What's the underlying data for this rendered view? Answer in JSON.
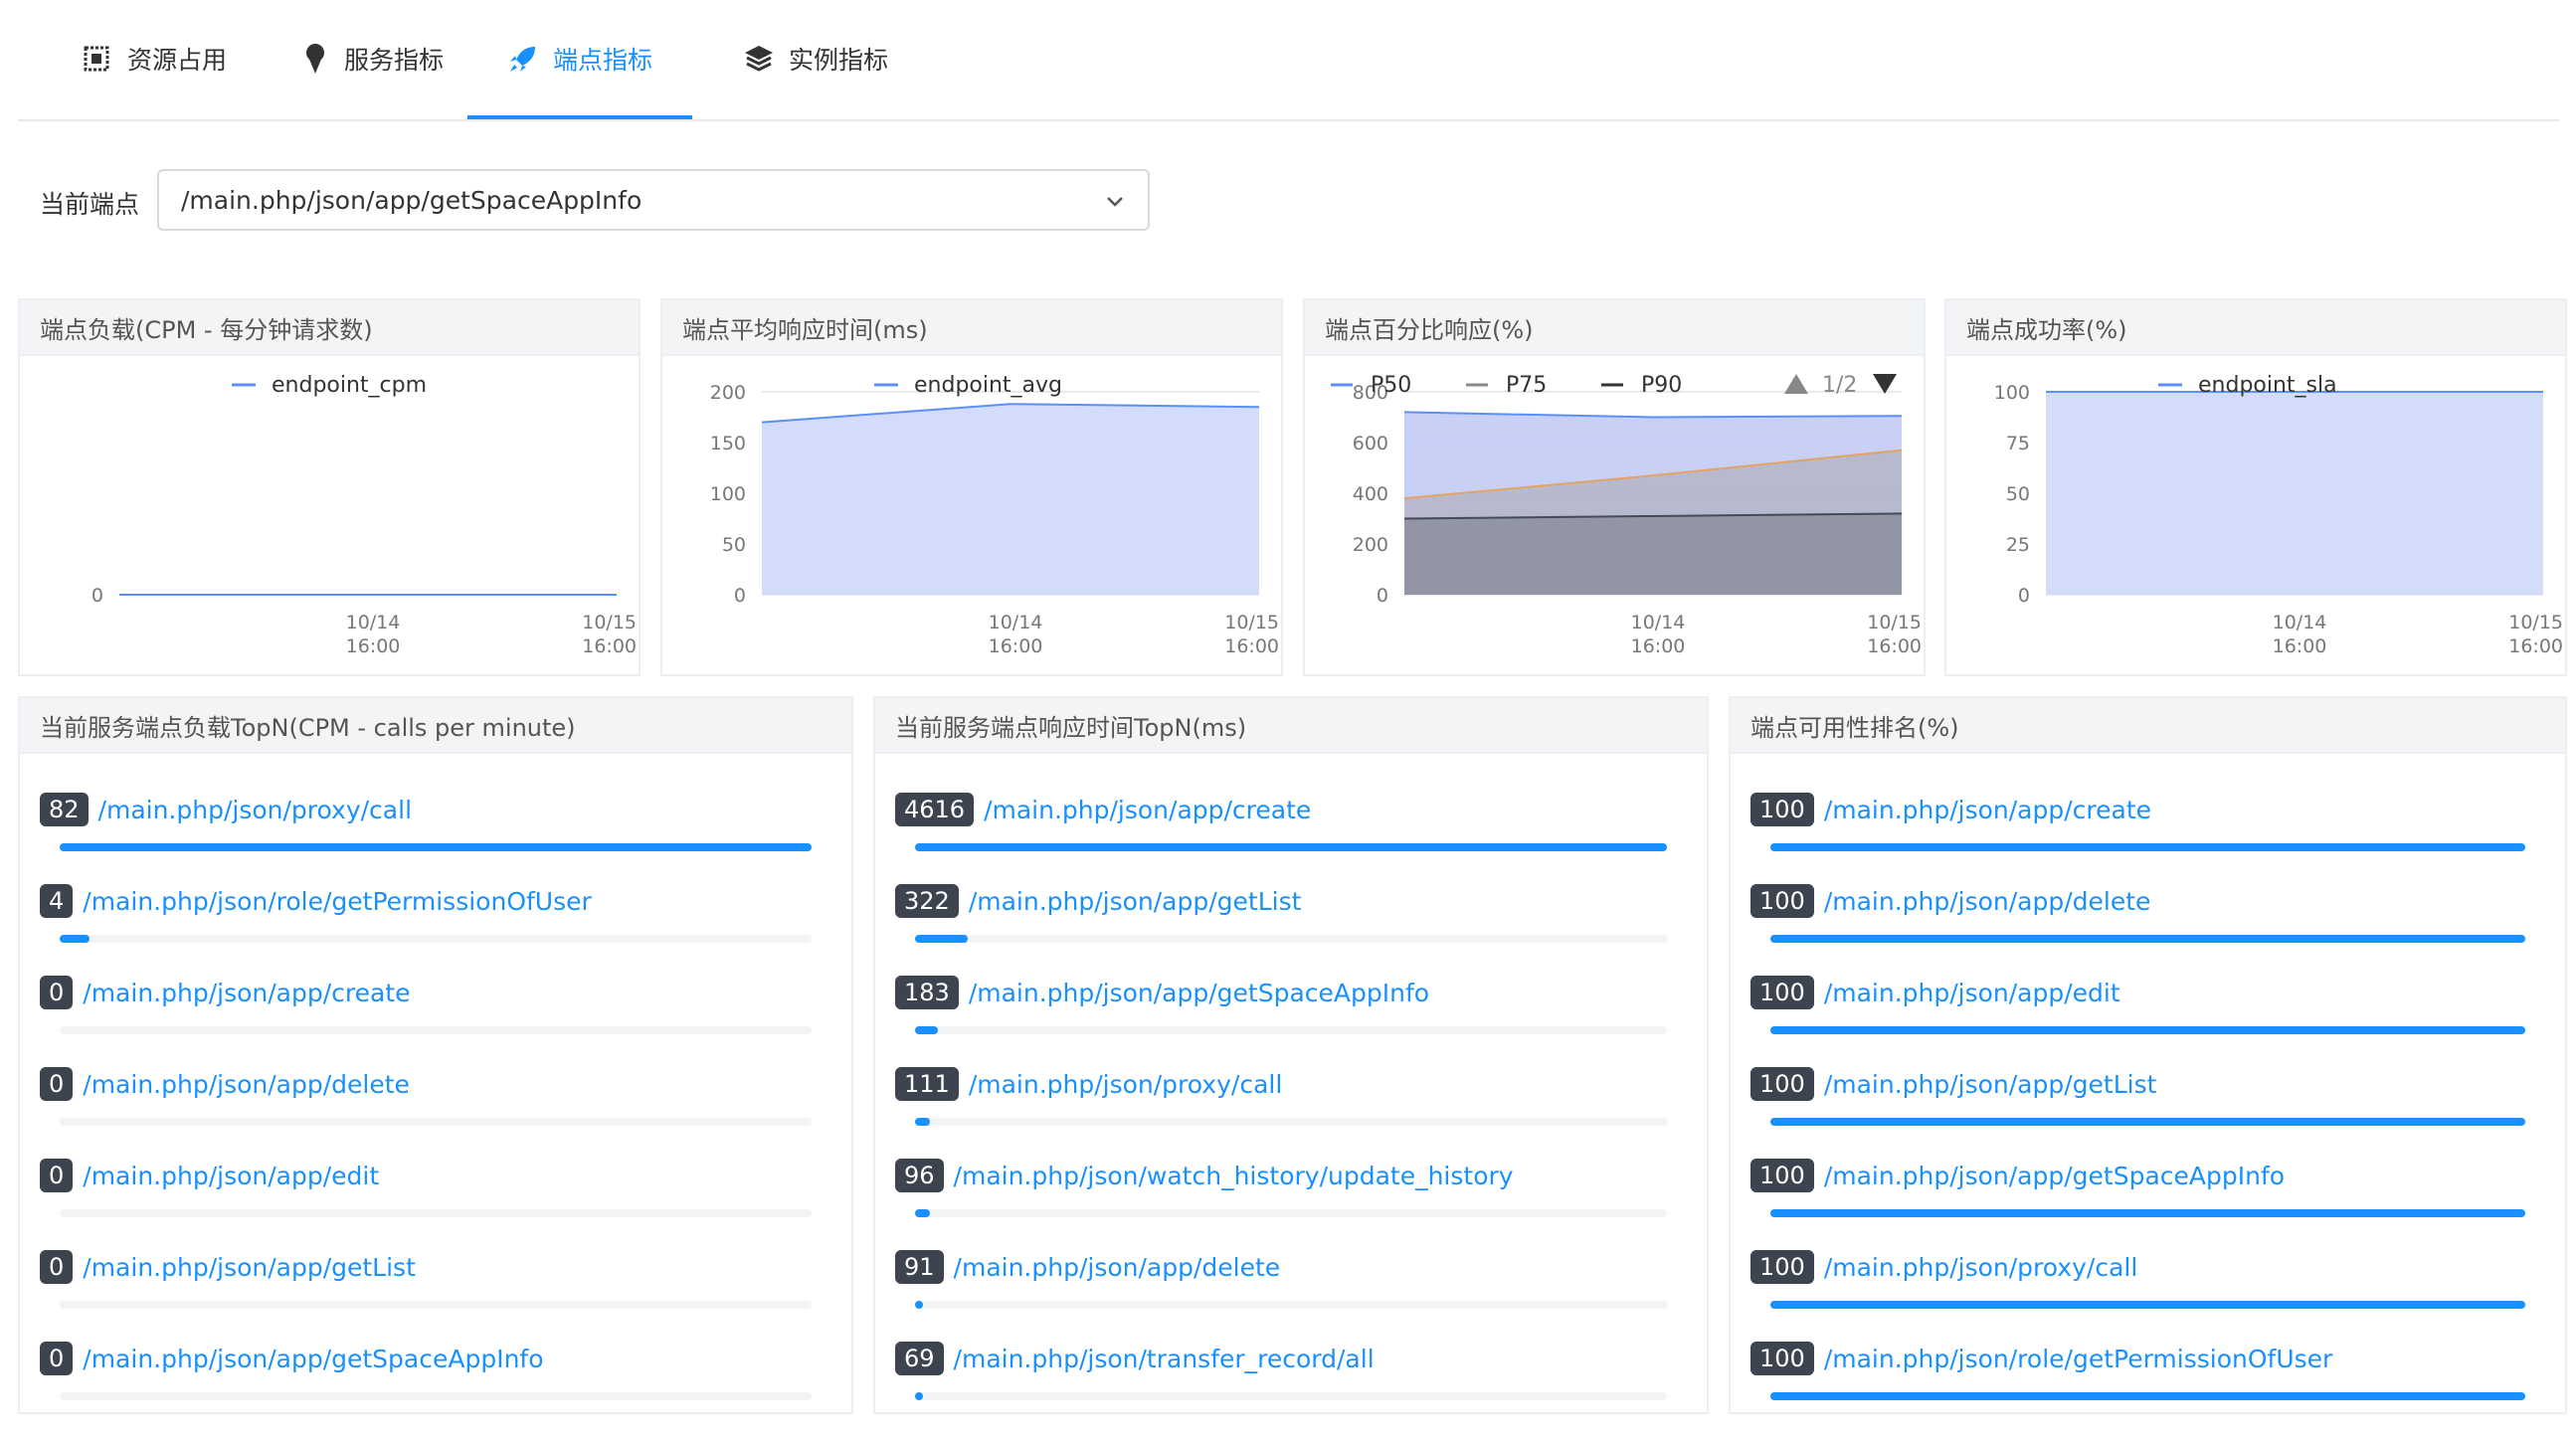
{
  "tabs": [
    {
      "label": "资源占用",
      "icon": "cpu-chip-icon"
    },
    {
      "label": "服务指标",
      "icon": "ice-cream-icon"
    },
    {
      "label": "端点指标",
      "icon": "rocket-icon",
      "active": true
    },
    {
      "label": "实例指标",
      "icon": "layers-icon"
    }
  ],
  "endpoint_select": {
    "label": "当前端点",
    "value": "/main.php/json/app/getSpaceAppInfo"
  },
  "colors": {
    "accent": "#1890ff",
    "badge": "#3d444f",
    "area_blue": "#d3dcfa",
    "p75": "#e3a363",
    "p90": "#444a56"
  },
  "charts": [
    {
      "title": "端点负载(CPM - 每分钟请求数)"
    },
    {
      "title": "端点平均响应时间(ms)"
    },
    {
      "title": "端点百分比响应(%)",
      "pager": "1/2"
    },
    {
      "title": "端点成功率(%)"
    }
  ],
  "chart_data": [
    {
      "type": "line",
      "title": "端点负载(CPM - 每分钟请求数)",
      "x": [
        "10/14 16:00",
        "10/15 16:00"
      ],
      "series": [
        {
          "name": "endpoint_cpm",
          "values": [
            0,
            0,
            0
          ]
        }
      ],
      "yticks": [
        0
      ],
      "ylim": [
        0,
        1
      ],
      "legend": "top-center"
    },
    {
      "type": "area",
      "title": "端点平均响应时间(ms)",
      "x": [
        "10/14 16:00",
        "10/15 16:00"
      ],
      "series": [
        {
          "name": "endpoint_avg",
          "values": [
            170,
            188,
            185
          ]
        }
      ],
      "yticks": [
        0,
        50,
        100,
        150,
        200
      ],
      "ylim": [
        0,
        200
      ],
      "legend": "top-center"
    },
    {
      "type": "area",
      "title": "端点百分比响应(%)",
      "x": [
        "10/14 16:00",
        "10/15 16:00"
      ],
      "series": [
        {
          "name": "P50",
          "values": [
            720,
            700,
            705
          ]
        },
        {
          "name": "P75",
          "values": [
            380,
            470,
            570
          ]
        },
        {
          "name": "P90",
          "values": [
            300,
            310,
            320
          ]
        }
      ],
      "yticks": [
        0,
        200,
        400,
        600,
        800
      ],
      "ylim": [
        0,
        800
      ],
      "legend": "top-left"
    },
    {
      "type": "area",
      "title": "端点成功率(%)",
      "x": [
        "10/14 16:00",
        "10/15 16:00"
      ],
      "series": [
        {
          "name": "endpoint_sla",
          "values": [
            100,
            100,
            100
          ]
        }
      ],
      "yticks": [
        0,
        25,
        50,
        75,
        100
      ],
      "ylim": [
        0,
        100
      ],
      "legend": "top-center"
    }
  ],
  "topn": [
    {
      "title": "当前服务端点负载TopN(CPM - calls per minute)",
      "items": [
        {
          "value": "82",
          "name": "/main.php/json/proxy/call",
          "fill": 1.0
        },
        {
          "value": "4",
          "name": "/main.php/json/role/getPermissionOfUser",
          "fill": 0.04
        },
        {
          "value": "0",
          "name": "/main.php/json/app/create",
          "fill": 0
        },
        {
          "value": "0",
          "name": "/main.php/json/app/delete",
          "fill": 0
        },
        {
          "value": "0",
          "name": "/main.php/json/app/edit",
          "fill": 0
        },
        {
          "value": "0",
          "name": "/main.php/json/app/getList",
          "fill": 0
        },
        {
          "value": "0",
          "name": "/main.php/json/app/getSpaceAppInfo",
          "fill": 0
        }
      ]
    },
    {
      "title": "当前服务端点响应时间TopN(ms)",
      "items": [
        {
          "value": "4616",
          "name": "/main.php/json/app/create",
          "fill": 1.0
        },
        {
          "value": "322",
          "name": "/main.php/json/app/getList",
          "fill": 0.07
        },
        {
          "value": "183",
          "name": "/main.php/json/app/getSpaceAppInfo",
          "fill": 0.03
        },
        {
          "value": "111",
          "name": "/main.php/json/proxy/call",
          "fill": 0.02
        },
        {
          "value": "96",
          "name": "/main.php/json/watch_history/update_history",
          "fill": 0.02
        },
        {
          "value": "91",
          "name": "/main.php/json/app/delete",
          "fill": 0.01
        },
        {
          "value": "69",
          "name": "/main.php/json/transfer_record/all",
          "fill": 0.01
        }
      ]
    },
    {
      "title": "端点可用性排名(%)",
      "items": [
        {
          "value": "100",
          "name": "/main.php/json/app/create",
          "fill": 1.0
        },
        {
          "value": "100",
          "name": "/main.php/json/app/delete",
          "fill": 1.0
        },
        {
          "value": "100",
          "name": "/main.php/json/app/edit",
          "fill": 1.0
        },
        {
          "value": "100",
          "name": "/main.php/json/app/getList",
          "fill": 1.0
        },
        {
          "value": "100",
          "name": "/main.php/json/app/getSpaceAppInfo",
          "fill": 1.0
        },
        {
          "value": "100",
          "name": "/main.php/json/proxy/call",
          "fill": 1.0
        },
        {
          "value": "100",
          "name": "/main.php/json/role/getPermissionOfUser",
          "fill": 1.0
        }
      ]
    }
  ]
}
